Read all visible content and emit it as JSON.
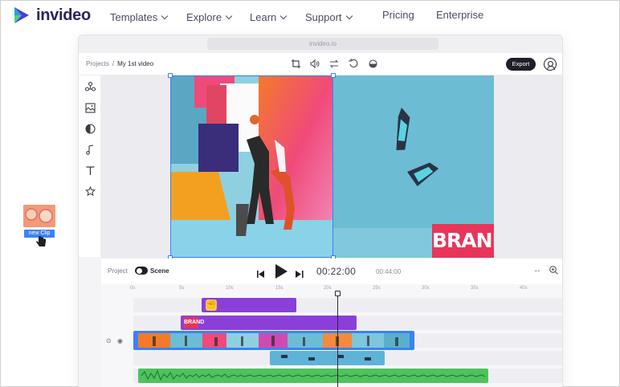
{
  "brand": {
    "name": "invideo"
  },
  "nav": {
    "items": [
      {
        "label": "Templates",
        "has_dropdown": true
      },
      {
        "label": "Explore",
        "has_dropdown": true
      },
      {
        "label": "Learn",
        "has_dropdown": true
      },
      {
        "label": "Support",
        "has_dropdown": true
      },
      {
        "label": "Pricing",
        "has_dropdown": false
      },
      {
        "label": "Enterprise",
        "has_dropdown": false
      }
    ]
  },
  "browser": {
    "url": "invideo.io"
  },
  "editor": {
    "breadcrumb": {
      "root": "Projects",
      "current": "My 1st video"
    },
    "toolbar_icons": [
      "crop-icon",
      "volume-icon",
      "swap-icon",
      "rotate-icon",
      "opacity-icon"
    ],
    "export_label": "Export",
    "sidebar_icons": [
      "elements-icon",
      "media-icon",
      "sticker-icon",
      "music-icon",
      "text-icon",
      "effects-icon"
    ],
    "canvas": {
      "overlay_text": "BRAND"
    },
    "controls": {
      "project_label": "Project",
      "scene_label": "Scene",
      "current_time": "00:22:00",
      "total_time": "00:44:00"
    },
    "timeline": {
      "ruler": [
        "0s",
        "5s",
        "10s",
        "15s",
        "20s",
        "25s",
        "30s",
        "35s",
        "40s"
      ],
      "tracks": [
        "sticker",
        "text",
        "video",
        "video-overlay",
        "audio"
      ]
    }
  },
  "drag_clip": {
    "label": "new Clip"
  },
  "colors": {
    "accent": "#3b82f6",
    "brand_dark": "#2a2460",
    "clip_purple": "#8b3fd9",
    "clip_blue": "#5eb3d6",
    "audio_green": "#4cc35c",
    "brand_pink": "#e8355a"
  }
}
